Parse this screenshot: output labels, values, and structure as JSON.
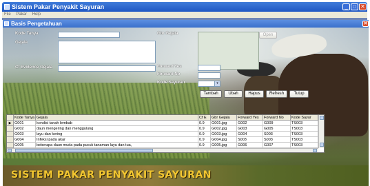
{
  "app": {
    "title": "Sistem Pakar Penyakit Sayuran",
    "menu": [
      "File",
      "Pakar",
      "Help"
    ],
    "window_buttons": {
      "minimize": "_",
      "maximize": "□",
      "close": "✕"
    }
  },
  "form": {
    "title": "Basis Pengetahuan",
    "close": "✕",
    "labels": {
      "kode_tanya": "Kode Tanya",
      "gejala": "Gejala",
      "cf_evidence": "Cf Evidence Gejala",
      "gbr_gejala": "Gbr Gejala",
      "forward_yes": "Forward Yes",
      "forward_no": "Forward No",
      "kode_sayuran": "Kode Sayuran"
    },
    "fields": {
      "kode_tanya": "",
      "gejala": "",
      "cf_evidence": "",
      "forward_yes": "",
      "forward_no": "",
      "kode_sayuran": ""
    },
    "open_button": "Open",
    "buttons": {
      "tambah": "Tambah",
      "ubah": "Ubah",
      "hapus": "Hapus",
      "refresh": "Refresh",
      "tutup": "Tutup"
    },
    "icons": {
      "combo": "chevron-down-icon",
      "row_pointer": "▶"
    }
  },
  "grid": {
    "columns": [
      "Kode Tanya",
      "Gejala",
      "Cf E",
      "Gbr Gejala",
      "Forward Yes",
      "Forward No",
      "Kode Sayur"
    ],
    "rows": [
      [
        "G001",
        "kondisi tanah lembab",
        "0.9",
        "G001.jpg",
        "G002",
        "G009",
        "TS003"
      ],
      [
        "G002",
        "daun mengering dan menggulung",
        "0.9",
        "G002.jpg",
        "G003",
        "G005",
        "TS003"
      ],
      [
        "G003",
        "layu dan kering",
        "0.9",
        "G003.jpg",
        "G004",
        "S003",
        "TS003"
      ],
      [
        "G004",
        "Infeksi pada akar",
        "0.9",
        "G004.jpg",
        "S003",
        "S003",
        "TS003"
      ],
      [
        "G005",
        "beberapa daun muda pada pucuk tanaman layu dan tua,",
        "0.9",
        "G005.jpg",
        "G006",
        "G007",
        "TS003"
      ]
    ]
  },
  "banner": "SISTEM PAKAR PENYAKIT SAYURAN",
  "colors": {
    "banner_text": "#f2c630",
    "title_bar": "#1f57c4"
  }
}
